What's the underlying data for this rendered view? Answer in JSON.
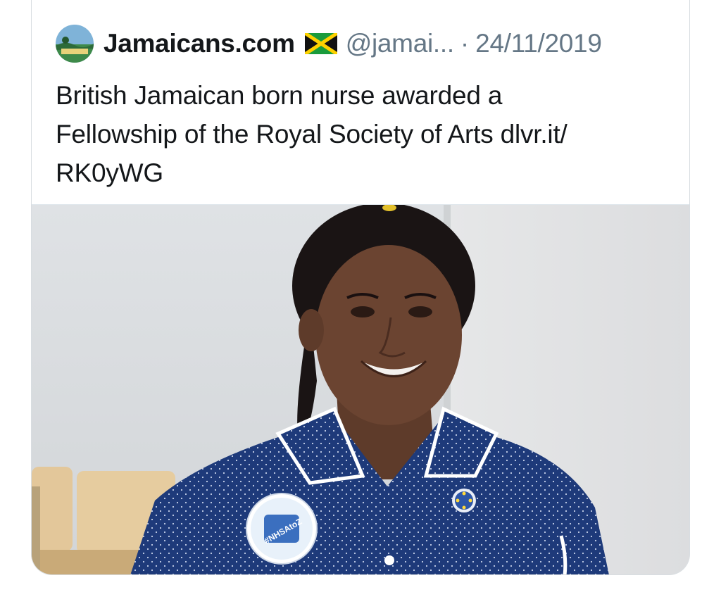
{
  "tweet": {
    "display_name": "Jamaicans.com",
    "flag_icon": "jamaica-flag-icon",
    "handle": "@jamai...",
    "separator": "·",
    "date": "24/11/2019",
    "text_lines": [
      "British Jamaican born nurse awarded a",
      "Fellowship of the Royal Society of Arts dlvr.it/",
      "RK0yWG"
    ]
  },
  "media": {
    "badge_text": "#NHSAtoZ",
    "colors": {
      "wall": "#dfe3e6",
      "uniform": "#1e3a7a",
      "skin": "#6b4431",
      "chair": "#e3c79a"
    }
  },
  "colors": {
    "text_primary": "#14171a",
    "text_secondary": "#657786",
    "border": "#d8dde1"
  }
}
